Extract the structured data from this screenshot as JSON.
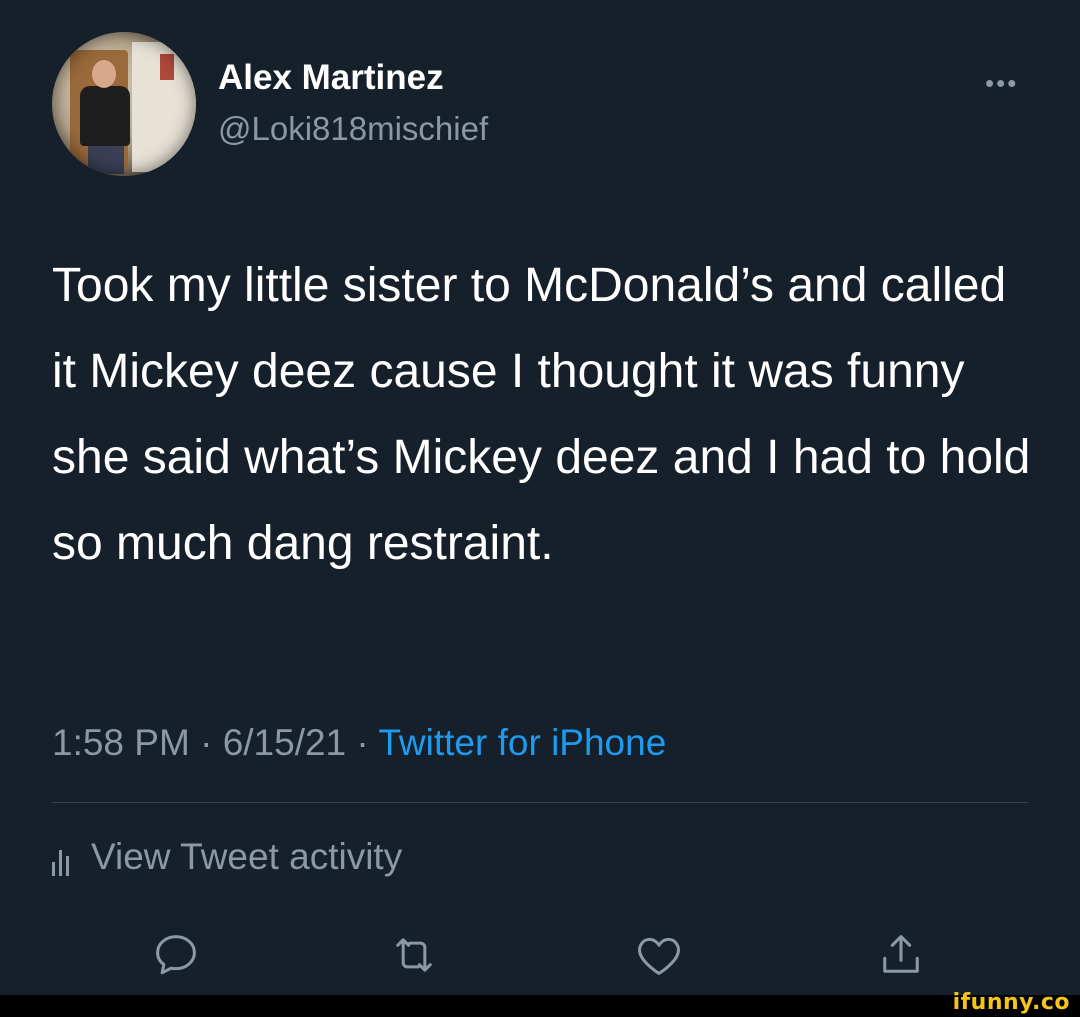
{
  "author": {
    "name": "Alex Martinez",
    "handle": "@Loki818mischief"
  },
  "tweet": {
    "text": "Took my little sister to McDonald’s and called it Mickey deez cause I thought it was funny she said what’s Mickey deez and I had to hold so much dang restraint.",
    "time": "1:58 PM",
    "date": "6/15/21",
    "separator": "·",
    "source": "Twitter for iPhone"
  },
  "activity_label": "View Tweet activity",
  "more_label": "•••",
  "actions": [
    "reply-icon",
    "retweet-icon",
    "like-icon",
    "share-icon"
  ],
  "watermark": "ifunny.co",
  "colors": {
    "background": "#15202b",
    "secondary_text": "#8b98a5",
    "link": "#1d9bf0",
    "watermark": "#f5c518"
  }
}
